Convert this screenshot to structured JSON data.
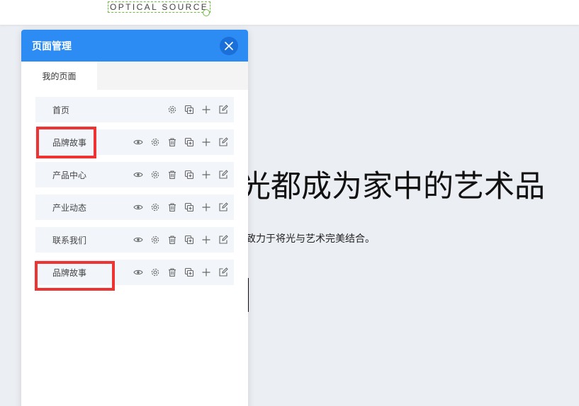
{
  "header": {
    "logo_text": "OPTICAL SOURCE"
  },
  "background": {
    "hero_title": "光都成为家中的艺术品",
    "hero_subtitle": "致力于将光与艺术完美结合。"
  },
  "panel": {
    "title": "页面管理",
    "close_icon": "close-icon",
    "tabs": [
      {
        "label": "我的页面",
        "active": true
      }
    ],
    "pages": [
      {
        "name": "首页",
        "actions": [
          "gear-icon",
          "copy-icon",
          "plus-icon",
          "edit-icon"
        ]
      },
      {
        "name": "品牌故事",
        "actions": [
          "eye-icon",
          "gear-icon",
          "trash-icon",
          "copy-icon",
          "plus-icon",
          "edit-icon"
        ]
      },
      {
        "name": "产品中心",
        "actions": [
          "eye-icon",
          "gear-icon",
          "trash-icon",
          "copy-icon",
          "plus-icon",
          "edit-icon"
        ]
      },
      {
        "name": "产业动态",
        "actions": [
          "eye-icon",
          "gear-icon",
          "trash-icon",
          "copy-icon",
          "plus-icon",
          "edit-icon"
        ]
      },
      {
        "name": "联系我们",
        "actions": [
          "eye-icon",
          "gear-icon",
          "trash-icon",
          "copy-icon",
          "plus-icon",
          "edit-icon"
        ]
      },
      {
        "name": "品牌故事",
        "actions": [
          "eye-icon",
          "gear-icon",
          "trash-icon",
          "copy-icon",
          "plus-icon",
          "edit-icon"
        ]
      }
    ]
  },
  "colors": {
    "panel_header": "#2c8cf4",
    "close_button": "#1a6fd8",
    "row_bg": "#f2f6fb",
    "highlight": "#ee3333",
    "selection_outline": "#6cbf3c"
  }
}
